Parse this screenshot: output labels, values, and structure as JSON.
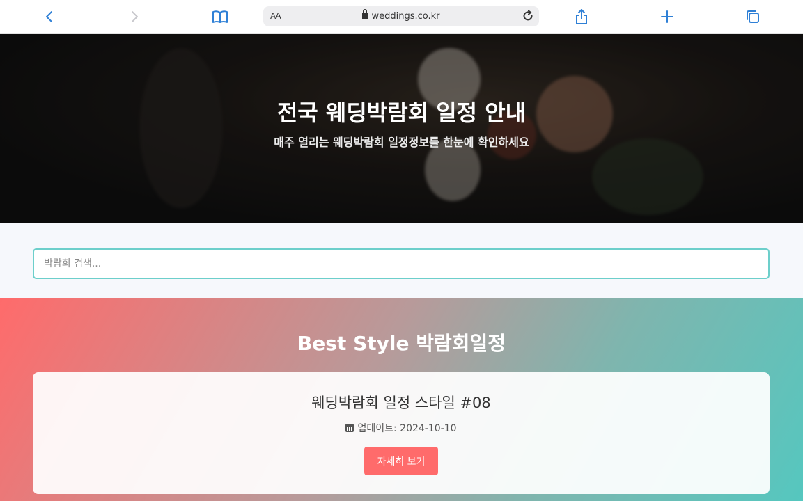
{
  "browser": {
    "aa_label": "AA",
    "url": "weddings.co.kr",
    "icons": [
      "back-icon",
      "forward-icon",
      "bookmarks-icon",
      "reload-icon",
      "share-icon",
      "new-tab-icon",
      "tabs-icon"
    ]
  },
  "hero": {
    "title": "전국 웨딩박람회 일정 안내",
    "subtitle": "매주 열리는 웨딩박람회 일정정보를 한눈에 확인하세요"
  },
  "search": {
    "placeholder": "박람회 검색...",
    "value": ""
  },
  "best": {
    "title": "Best Style 박람회일정",
    "card": {
      "title": "웨딩박람회 일정 스타일 #08",
      "updated": "업데이트: 2024-10-10",
      "button_label": "자세히 보기"
    }
  },
  "colors": {
    "accent": "#ff6b6b",
    "teal": "#55c7bf",
    "link_blue": "#2f80d6"
  }
}
